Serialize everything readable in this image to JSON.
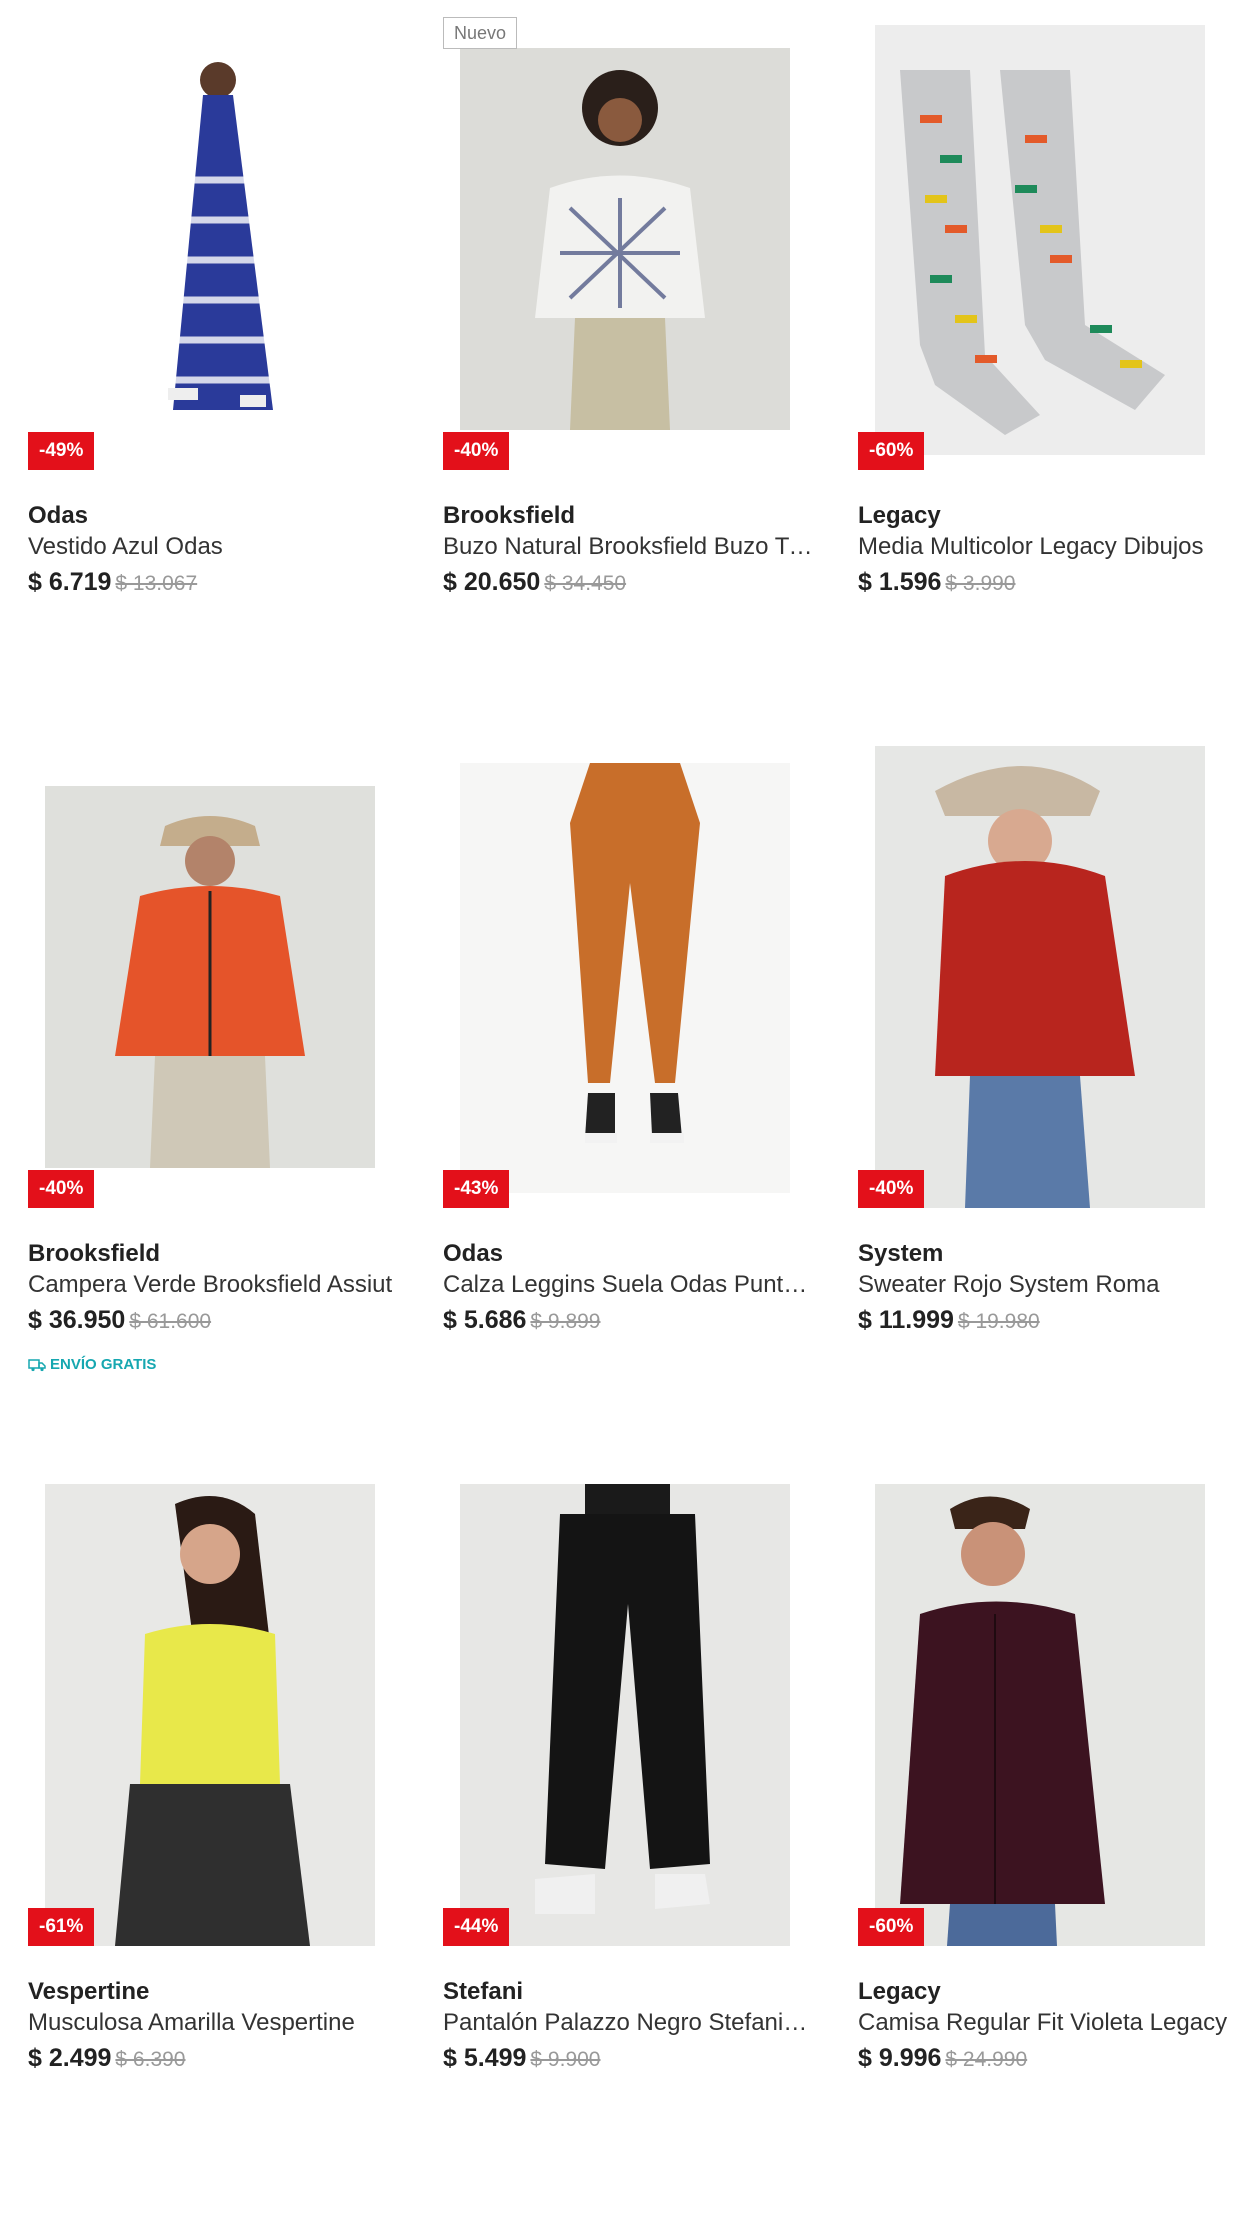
{
  "products": [
    {
      "badge_new": "",
      "discount": "-49%",
      "brand": "Odas",
      "name": "Vestido Azul Odas",
      "price": "$ 6.719",
      "old_price": "$ 13.067",
      "shipping": "",
      "image": "woman-blue-tie-dye-dress"
    },
    {
      "badge_new": "Nuevo",
      "discount": "-40%",
      "brand": "Brooksfield",
      "name": "Buzo Natural Brooksfield Buzo Tie Dye",
      "price": "$ 20.650",
      "old_price": "$ 34.450",
      "shipping": "",
      "image": "woman-tie-dye-sweatshirt"
    },
    {
      "badge_new": "",
      "discount": "-60%",
      "brand": "Legacy",
      "name": "Media Multicolor Legacy Dibujos",
      "price": "$ 1.596",
      "old_price": "$ 3.990",
      "shipping": "",
      "image": "grey-socks-sunglasses-print"
    },
    {
      "badge_new": "",
      "discount": "-40%",
      "brand": "Brooksfield",
      "name": "Campera Verde Brooksfield Assiut",
      "price": "$ 36.950",
      "old_price": "$ 61.600",
      "shipping": "ENVÍO GRATIS",
      "image": "man-orange-jacket"
    },
    {
      "badge_new": "",
      "discount": "-43%",
      "brand": "Odas",
      "name": "Calza Leggins Suela Odas Punto Roma",
      "price": "$ 5.686",
      "old_price": "$ 9.899",
      "shipping": "",
      "image": "woman-orange-leggings"
    },
    {
      "badge_new": "",
      "discount": "-40%",
      "brand": "System",
      "name": "Sweater Rojo System Roma",
      "price": "$ 11.999",
      "old_price": "$ 19.980",
      "shipping": "",
      "image": "woman-red-sweater"
    },
    {
      "badge_new": "",
      "discount": "-61%",
      "brand": "Vespertine",
      "name": "Musculosa Amarilla Vespertine",
      "price": "$ 2.499",
      "old_price": "$ 6.390",
      "shipping": "",
      "image": "woman-yellow-tank-top"
    },
    {
      "badge_new": "",
      "discount": "-44%",
      "brand": "Stefani",
      "name": "Pantalón Palazzo Negro Stefani Lino",
      "price": "$ 5.499",
      "old_price": "$ 9.900",
      "shipping": "",
      "image": "woman-black-palazzo-pants"
    },
    {
      "badge_new": "",
      "discount": "-60%",
      "brand": "Legacy",
      "name": "Camisa Regular Fit Violeta Legacy",
      "price": "$ 9.996",
      "old_price": "$ 24.990",
      "shipping": "",
      "image": "man-violet-shirt"
    }
  ],
  "colors": {
    "discount_bg": "#e3101a",
    "shipping_text": "#16a7b0",
    "old_price": "#999999"
  }
}
